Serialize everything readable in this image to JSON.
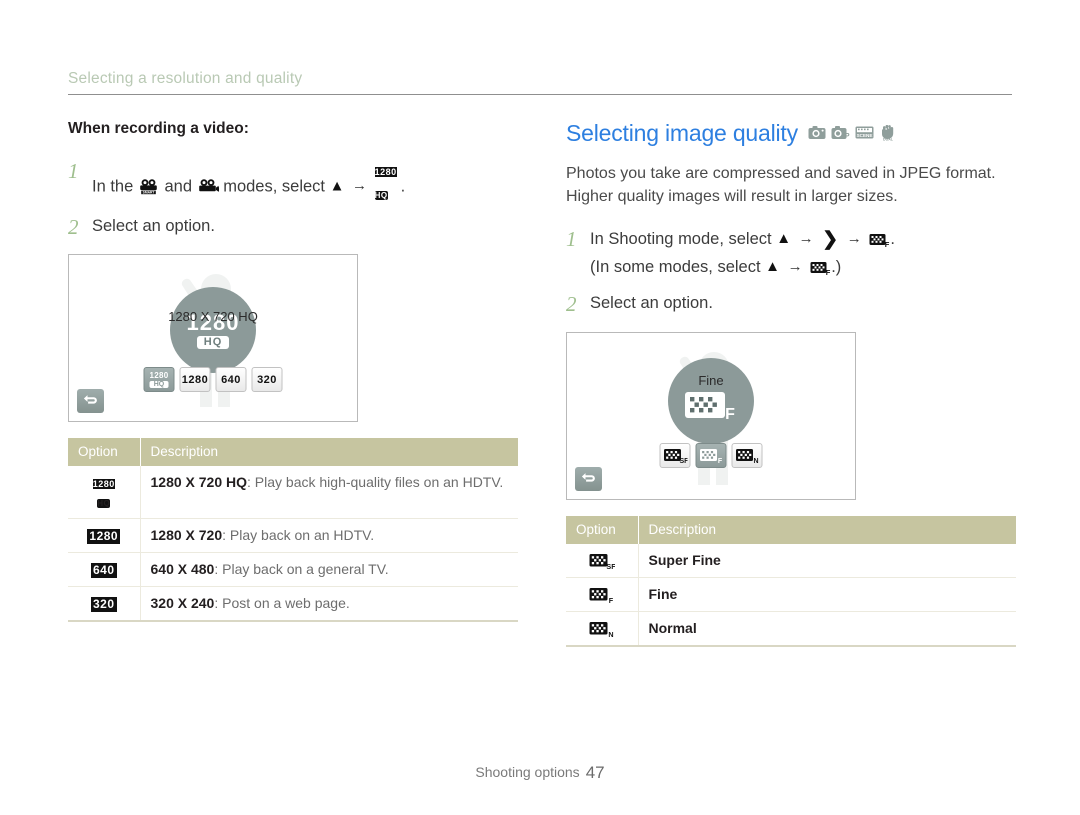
{
  "running_header": {
    "text": "Selecting a resolution and quality"
  },
  "left_column": {
    "subheading": "When recording a video:",
    "step1": {
      "number": "1",
      "text_a": "In the",
      "text_b": "and",
      "text_c": "modes, select",
      "icon_mode_1": "camcorder-smart-icon",
      "icon_mode_2": "camcorder-icon",
      "icon_up": "▲",
      "arrow": "→",
      "icon_result": "1280-hq-icon",
      "period": "."
    },
    "step2": {
      "number": "2",
      "text": "Select an option."
    },
    "lcd": {
      "caption": "1280 X 720 HQ",
      "dial_big": "1280",
      "dial_pill": "HQ",
      "back_icon": "back-arrow-icon",
      "options": [
        {
          "label_top": "1280",
          "label_bottom": "HQ",
          "selected": true
        },
        {
          "label_top": "1280",
          "label_bottom": "",
          "selected": false
        },
        {
          "label_top": "640",
          "label_bottom": "",
          "selected": false
        },
        {
          "label_top": "320",
          "label_bottom": "",
          "selected": false
        }
      ]
    },
    "table": {
      "header_option": "Option",
      "header_description": "Description",
      "rows": [
        {
          "icon": "1280-hq-icon",
          "icon_top": "1280",
          "icon_bottom": "HQ",
          "bold": "1280 X 720 HQ",
          "rest": ": Play back high-quality files on an HDTV."
        },
        {
          "icon": "1280-icon",
          "icon_top": "1280",
          "icon_bottom": "",
          "bold": "1280 X 720",
          "rest": ": Play back on an HDTV."
        },
        {
          "icon": "640-icon",
          "icon_top": "640",
          "icon_bottom": "",
          "bold": "640 X 480",
          "rest": ": Play back on a general TV."
        },
        {
          "icon": "320-icon",
          "icon_top": "320",
          "icon_bottom": "",
          "bold": "320 X 240",
          "rest": ": Post on a web page."
        }
      ]
    }
  },
  "right_column": {
    "title": "Selecting image quality",
    "title_color": "#2d7fe0",
    "mode_icons": [
      {
        "name": "auto-camera-icon",
        "label": ""
      },
      {
        "name": "program-camera-icon",
        "label": "P"
      },
      {
        "name": "scene-mode-icon",
        "label": "SCENE"
      },
      {
        "name": "dual-is-mode-icon",
        "label": "DUAL IS"
      }
    ],
    "intro_line1": "Photos you take are compressed and saved in JPEG format.",
    "intro_line2": "Higher quality images will result in larger sizes.",
    "step1": {
      "number": "1",
      "text_a": "In Shooting mode, select",
      "arrow": "→",
      "icon_up": "▲",
      "icon_chevron": "❯",
      "icon_result": "quality-fine-icon",
      "period": ".",
      "sub_a": "(In some modes, select",
      "sub_period": ".)"
    },
    "step2": {
      "number": "2",
      "text": "Select an option."
    },
    "lcd": {
      "caption": "Fine",
      "back_icon": "back-arrow-icon",
      "options": [
        {
          "letter": "SF",
          "selected": false
        },
        {
          "letter": "F",
          "selected": true
        },
        {
          "letter": "N",
          "selected": false
        }
      ]
    },
    "table": {
      "header_option": "Option",
      "header_description": "Description",
      "rows": [
        {
          "icon": "quality-super-fine-icon",
          "letter": "SF",
          "label": "Super Fine"
        },
        {
          "icon": "quality-fine-icon",
          "letter": "F",
          "label": "Fine"
        },
        {
          "icon": "quality-normal-icon",
          "letter": "N",
          "label": "Normal"
        }
      ]
    }
  },
  "footer": {
    "section": "Shooting options",
    "page": "47"
  },
  "colors": {
    "heading_blue": "#2d7fe0",
    "running_head": "#b9c9b4",
    "step_number": "#9fbf8e",
    "table_header_bg": "#c6c5a0",
    "dial_gray": "#8c9a99"
  }
}
